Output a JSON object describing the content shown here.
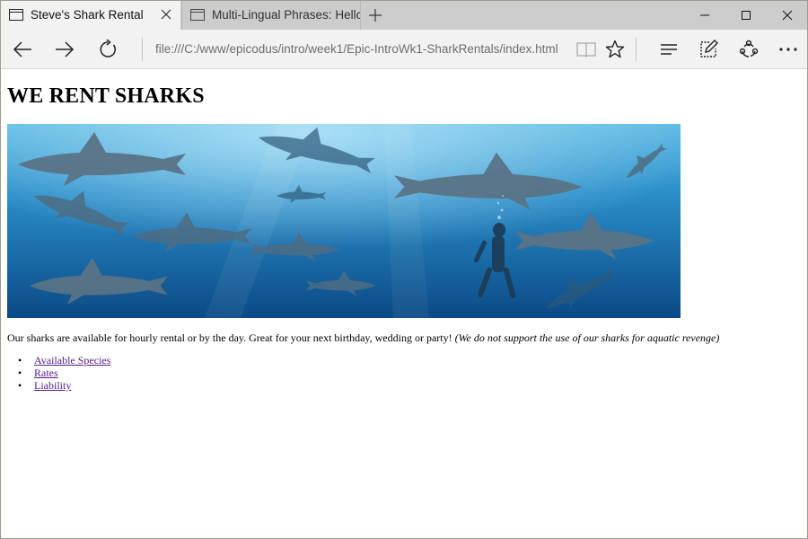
{
  "browser": {
    "tabs": [
      {
        "title": "Steve's Shark Rental",
        "active": true
      },
      {
        "title": "Multi-Lingual Phrases: Hellc",
        "active": false
      }
    ],
    "address": "file:///C:/www/epicodus/intro/week1/Epic-IntroWk1-SharkRentals/index.html",
    "icons": {
      "tab_icon": "tab-page-icon",
      "close_tab": "close-icon",
      "new_tab": "plus-icon",
      "back": "back-arrow-icon",
      "forward": "forward-arrow-icon",
      "refresh": "refresh-icon",
      "reading_view": "book-icon",
      "favorite": "star-icon",
      "hub": "hub-icon",
      "web_note": "pen-note-icon",
      "share": "share-icon",
      "more": "more-icon",
      "minimize": "minimize-icon",
      "maximize": "maximize-icon",
      "close_window": "close-icon"
    }
  },
  "page": {
    "heading": "WE RENT SHARKS",
    "hero_image": "underwater photo of many sharks swimming around a diver",
    "intro_text": "Our sharks are available for hourly rental or by the day. Great for your next birthday, wedding or party!",
    "intro_note": "(We do not support the use of our sharks for aquatic revenge)",
    "links": [
      {
        "label": "Available Species"
      },
      {
        "label": "Rates"
      },
      {
        "label": "Liability"
      }
    ]
  },
  "colors": {
    "tab_strip": "#cccccc",
    "toolbar": "#f2f2f2",
    "visited_link": "#551a8b",
    "ocean_deep": "#0a4f87",
    "ocean_light": "#3fa3d6"
  }
}
